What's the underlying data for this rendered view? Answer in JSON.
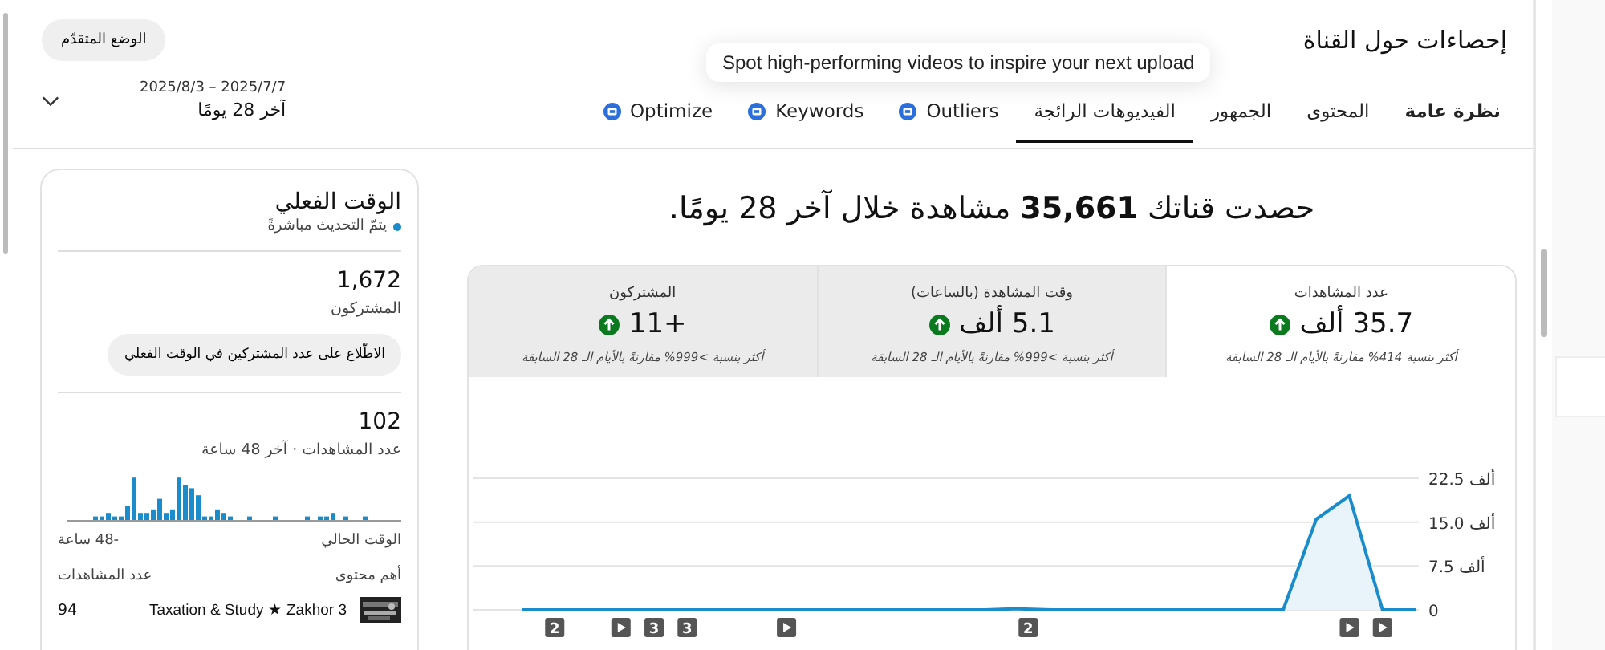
{
  "header": {
    "title": "إحصاءات حول القناة",
    "mode_button": "الوضع المتقدّم",
    "date_range": "2025/8/3 – 2025/7/7",
    "period": "آخر 28 يومًا"
  },
  "tooltip": "Spot high-performing videos to inspire your next upload",
  "tabs": [
    {
      "label": "نظرة عامة",
      "selected": false,
      "badge": false
    },
    {
      "label": "المحتوى",
      "selected": false,
      "badge": false
    },
    {
      "label": "الجمهور",
      "selected": false,
      "badge": false
    },
    {
      "label": "الفيديوهات الرائجة",
      "selected": true,
      "badge": false
    },
    {
      "label": "Outliers",
      "selected": false,
      "badge": true
    },
    {
      "label": "Keywords",
      "selected": false,
      "badge": true
    },
    {
      "label": "Optimize",
      "selected": false,
      "badge": true
    }
  ],
  "headline": "حصدت قناتك **35,661** مشاهدة خلال آخر 28 يومًا.",
  "metrics": [
    {
      "title": "عدد المشاهدات",
      "value": "35.7 ألف",
      "note": "أكثر بنسبة 414% مقارنةً بالأيام الـ 28 السابقة",
      "selected": true
    },
    {
      "title": "وقت المشاهدة (بالساعات)",
      "value": "5.1 ألف",
      "note": "أكثر بنسبة >999% مقارنةً بالأيام الـ 28 السابقة",
      "selected": false
    },
    {
      "title": "المشتركون",
      "value": "+11",
      "note": "أكثر بنسبة >999% مقارنةً بالأيام الـ 28 السابقة",
      "selected": false
    }
  ],
  "chart_data": {
    "type": "area",
    "values": [
      0,
      0,
      0,
      0,
      0,
      0,
      0,
      0,
      0,
      0,
      0,
      0,
      0,
      0,
      0,
      0.2,
      0,
      0,
      0,
      0,
      0,
      0,
      0,
      0,
      15.5,
      19.5,
      0,
      0
    ],
    "ylim": [
      0,
      22.5
    ],
    "yticks": [
      {
        "value": 0,
        "label": "0"
      },
      {
        "value": 7.5,
        "label": "7.5 ألف"
      },
      {
        "value": 15,
        "label": "15.0 ألف"
      },
      {
        "value": 22.5,
        "label": "22.5 ألف"
      }
    ]
  },
  "chart_markers": [
    {
      "kind": "video"
    },
    {
      "kind": "video"
    },
    {
      "kind": "count",
      "label": "2"
    },
    {
      "kind": "video"
    },
    {
      "kind": "count",
      "label": "3"
    },
    {
      "kind": "count",
      "label": "3"
    },
    {
      "kind": "video"
    },
    {
      "kind": "count",
      "label": "2"
    }
  ],
  "realtime": {
    "title": "الوقت الفعلي",
    "live": "يتمّ التحديث مباشرةً",
    "subscribers": "1,672",
    "subscribers_label": "المشتركون",
    "subscribers_button": "الاطّلاع على عدد المشتركين في الوقت الفعلي",
    "views": "102",
    "views_label": "عدد المشاهدات · آخر 48 ساعة",
    "axis_now": "الوقت الحالي",
    "axis_start": "-48 ساعة",
    "top_label": "أهم محتوى",
    "top_views_label": "عدد المشاهدات",
    "top_items": [
      {
        "title": "Taxation & Study ★ Zakhor 3",
        "views": "94"
      }
    ]
  }
}
